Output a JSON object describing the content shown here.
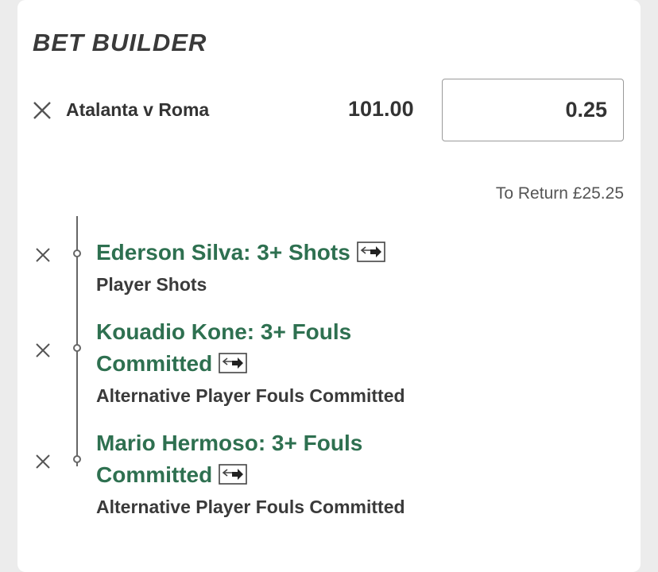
{
  "header": {
    "title": "BET BUILDER"
  },
  "bet": {
    "event": "Atalanta v Roma",
    "odds": "101.00",
    "stake": "0.25",
    "to_return_label": "To Return",
    "to_return_value": "£25.25"
  },
  "selections": [
    {
      "name": "Ederson Silva: 3+ Shots",
      "market": "Player Shots",
      "icon": "swap-icon"
    },
    {
      "name": "Kouadio Kone: 3+ Fouls Committed",
      "market": "Alternative Player Fouls Committed",
      "icon": "swap-icon"
    },
    {
      "name": "Mario Hermoso: 3+ Fouls Committed",
      "market": "Alternative Player Fouls Committed",
      "icon": "swap-icon"
    }
  ],
  "icons": {
    "remove": "close-icon"
  },
  "colors": {
    "accent": "#2e7050",
    "text": "#333333"
  }
}
